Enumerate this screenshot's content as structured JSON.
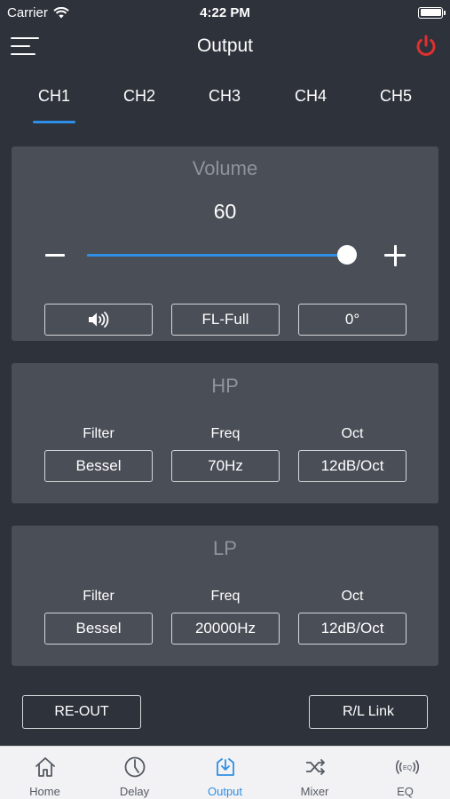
{
  "status_bar": {
    "carrier": "Carrier",
    "time": "4:22 PM"
  },
  "nav": {
    "title": "Output"
  },
  "channels": [
    "CH1",
    "CH2",
    "CH3",
    "CH4",
    "CH5"
  ],
  "active_channel": "CH1",
  "volume": {
    "title": "Volume",
    "value": "60",
    "level": 0.97,
    "speaker_icon": "speaker-icon",
    "position_label": "FL-Full",
    "phase_label": "0°"
  },
  "hp": {
    "title": "HP",
    "filter_label": "Filter",
    "filter_value": "Bessel",
    "freq_label": "Freq",
    "freq_value": "70Hz",
    "oct_label": "Oct",
    "oct_value": "12dB/Oct"
  },
  "lp": {
    "title": "LP",
    "filter_label": "Filter",
    "filter_value": "Bessel",
    "freq_label": "Freq",
    "freq_value": "20000Hz",
    "oct_label": "Oct",
    "oct_value": "12dB/Oct"
  },
  "actions": {
    "re_out": "RE-OUT",
    "rl_link": "R/L Link"
  },
  "tab_bar": {
    "items": [
      {
        "label": "Home",
        "icon": "home-icon"
      },
      {
        "label": "Delay",
        "icon": "clock-icon"
      },
      {
        "label": "Output",
        "icon": "output-icon"
      },
      {
        "label": "Mixer",
        "icon": "shuffle-icon"
      },
      {
        "label": "EQ",
        "icon": "eq-icon"
      }
    ],
    "active": "Output"
  },
  "colors": {
    "background": "#2e323b",
    "panel": "#4a4e57",
    "accent": "#2f8fe6",
    "power": "#e0312f",
    "tab_bar": "#f2f2f4"
  }
}
